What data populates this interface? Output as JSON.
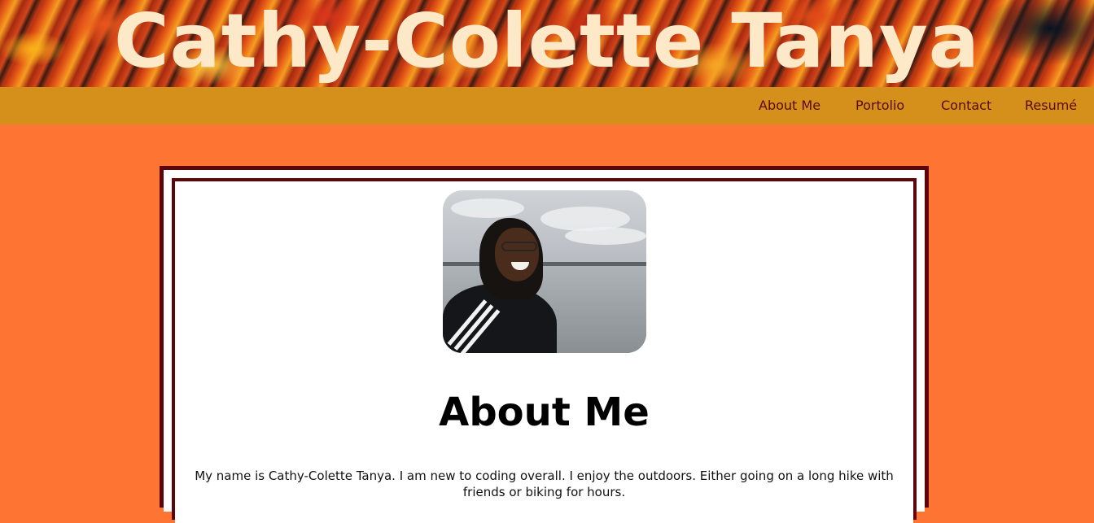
{
  "header": {
    "title": "Cathy-Colette Tanya"
  },
  "nav": {
    "items": [
      {
        "label": "About Me"
      },
      {
        "label": "Portolio"
      },
      {
        "label": "Contact"
      },
      {
        "label": "Resumé"
      }
    ]
  },
  "about": {
    "heading": "About Me",
    "bio": "My name is Cathy-Colette Tanya. I am new to coding overall. I enjoy the outdoors. Either going on a long hike with friends or biking for hours."
  },
  "colors": {
    "page_background": "#fe7433",
    "nav_background": "#d4901a",
    "nav_text": "#5a0a06",
    "title_text": "#fde9c8",
    "card_border": "#5e0509"
  }
}
